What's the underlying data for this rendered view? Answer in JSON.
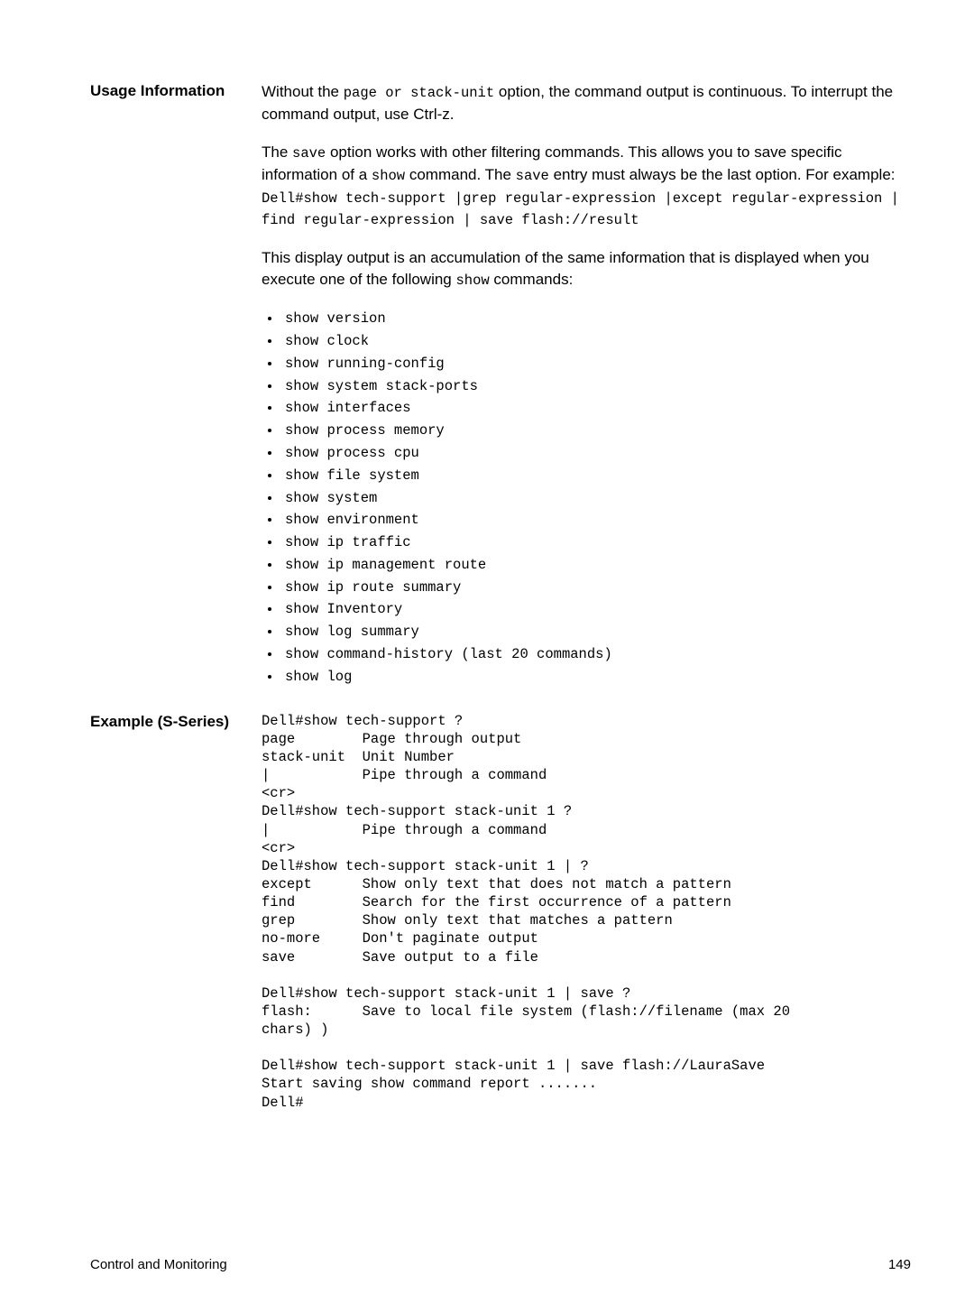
{
  "usage": {
    "label": "Usage Information",
    "para1_parts": [
      "Without the ",
      "page or stack-unit",
      " option, the command output is continuous. To interrupt the command output, use Ctrl-z."
    ],
    "para2_parts": [
      "The ",
      "save",
      " option works with other filtering commands. This allows you to save specific information of a ",
      "show",
      " command. The ",
      "save",
      " entry must always be the last option. For example: ",
      "Dell#show tech-support |grep regular-expression |except regular-expression | find regular-expression | save flash://result"
    ],
    "para3_parts": [
      "This display output is an accumulation of the same information that is displayed when you execute one of the following ",
      "show",
      " commands:"
    ],
    "bullets": [
      "show version",
      "show clock",
      "show running-config",
      "show system stack-ports",
      "show interfaces",
      "show process memory",
      "show process cpu",
      "show file system",
      "show system",
      "show environment",
      "show ip traffic",
      "show ip management route",
      "show ip route summary",
      "show Inventory",
      "show log summary",
      "show command-history (last 20 commands)",
      "show log"
    ]
  },
  "example": {
    "label": "Example (S-Series)",
    "terminal": "Dell#show tech-support ?\npage        Page through output\nstack-unit  Unit Number\n|           Pipe through a command\n<cr>\nDell#show tech-support stack-unit 1 ?\n|           Pipe through a command\n<cr>\nDell#show tech-support stack-unit 1 | ?\nexcept      Show only text that does not match a pattern\nfind        Search for the first occurrence of a pattern\ngrep        Show only text that matches a pattern\nno-more     Don't paginate output\nsave        Save output to a file\n\nDell#show tech-support stack-unit 1 | save ?\nflash:      Save to local file system (flash://filename (max 20\nchars) )\n\nDell#show tech-support stack-unit 1 | save flash://LauraSave\nStart saving show command report .......\nDell#"
  },
  "footer": {
    "left": "Control and Monitoring",
    "right": "149"
  }
}
